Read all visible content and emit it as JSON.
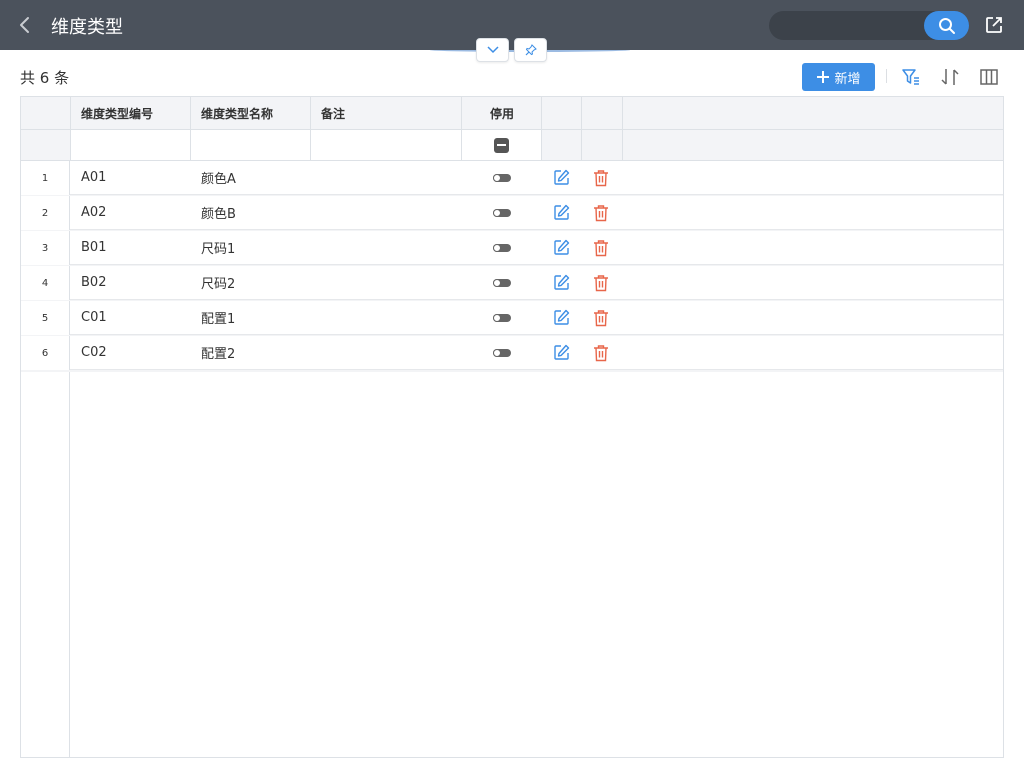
{
  "header": {
    "title": "维度类型",
    "search_placeholder": ""
  },
  "toolbar": {
    "count_label": "共 6 条",
    "add_label": "新增"
  },
  "table": {
    "columns": [
      "维度类型编号",
      "维度类型名称",
      "备注",
      "停用"
    ],
    "rows": [
      {
        "num": "1",
        "code": "A01",
        "name": "颜色A",
        "remark": ""
      },
      {
        "num": "2",
        "code": "A02",
        "name": "颜色B",
        "remark": ""
      },
      {
        "num": "3",
        "code": "B01",
        "name": "尺码1",
        "remark": ""
      },
      {
        "num": "4",
        "code": "B02",
        "name": "尺码2",
        "remark": ""
      },
      {
        "num": "5",
        "code": "C01",
        "name": "配置1",
        "remark": ""
      },
      {
        "num": "6",
        "code": "C02",
        "name": "配置2",
        "remark": ""
      }
    ]
  },
  "colors": {
    "header_bg": "#4b525c",
    "accent": "#3d8ee5",
    "delete": "#e8664a",
    "edit": "#3d8ee5"
  },
  "icons": {
    "back": "chevron-left-icon",
    "search": "search-icon",
    "share": "share-icon",
    "collapse": "chevron-down-icon",
    "pin": "pin-icon",
    "filter": "filter-icon",
    "sort": "sort-icon",
    "columns": "columns-icon",
    "edit": "edit-icon",
    "delete": "trash-icon"
  }
}
